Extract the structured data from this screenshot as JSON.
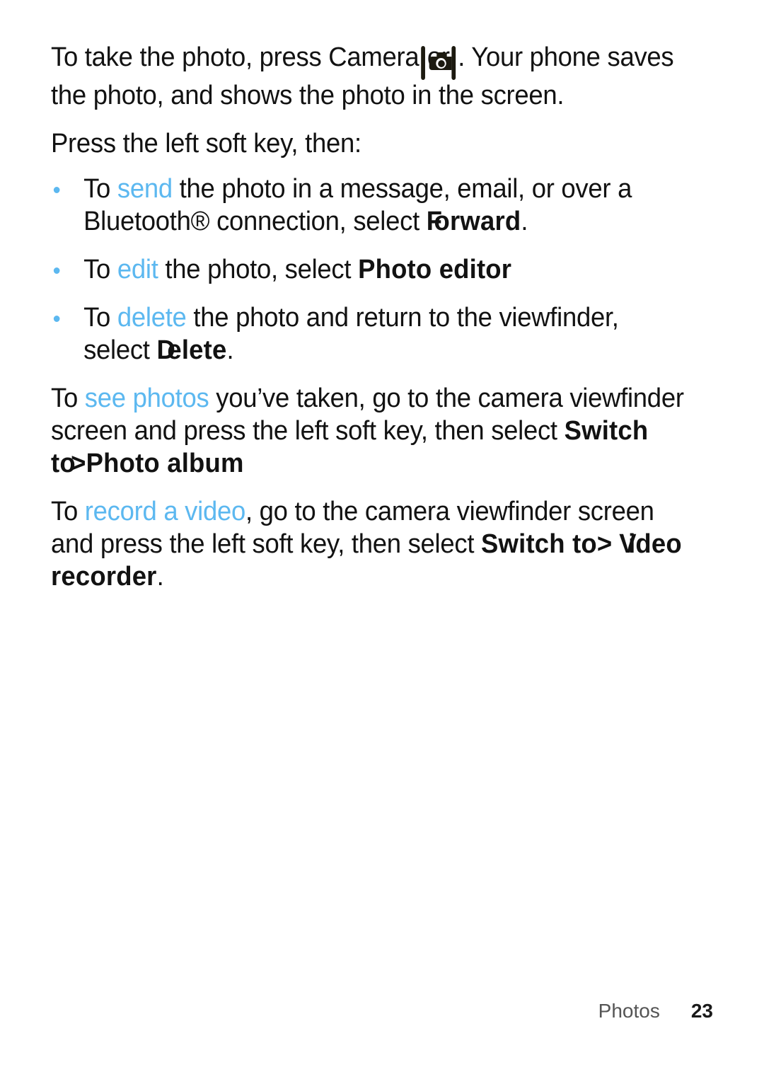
{
  "page": {
    "background": "#ffffff",
    "accent_color": "#5CB8F0",
    "text_color": "#121212"
  },
  "body": {
    "p1": {
      "seg1": "To take the photo, press Camera",
      "seg2": "or",
      "seg3": ". Your phone saves the photo, and shows the photo in the screen."
    },
    "p2": "Press the left soft key, then:",
    "bullets": [
      {
        "seg1": "To ",
        "accent": "send",
        "seg2": " the photo in a message, email, or over a Bluetooth® connection, select ",
        "menu_lead": "F",
        "menu_rest": "orward",
        "seg3": "."
      },
      {
        "seg1": "To ",
        "accent": "edit",
        "seg2": " the photo, select ",
        "menu": "Photo editor",
        "seg3": ""
      },
      {
        "seg1": "To ",
        "accent": "delete",
        "seg2": " the photo and return to the viewfinder, select ",
        "menu_lead": "D",
        "menu_rest": "elete",
        "seg3": "."
      }
    ],
    "p3": {
      "seg1": "To ",
      "accent": "see photos",
      "seg2": " you’ve taken, go to the camera viewfinder screen and press the left soft key, then select ",
      "menu1": "Switch to",
      "separator": ">",
      "menu2": "Photo album",
      "seg3": ""
    },
    "p4": {
      "seg1": "To ",
      "accent": "record a video",
      "seg2": ", go to the camera viewfinder screen and press the left soft key, then select ",
      "menu1": "Switch to",
      "separator": ">",
      "menu2_lead": "V",
      "menu2_rest": "ideo recorder",
      "seg3": "."
    }
  },
  "icons": {
    "camera_key": "camera-key-icon",
    "center_key": "center-select-key-icon"
  },
  "footer": {
    "section": "Photos",
    "page_number": "23"
  }
}
